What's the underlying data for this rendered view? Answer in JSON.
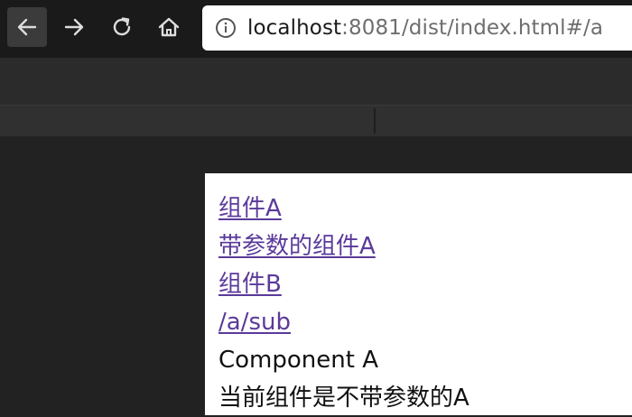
{
  "browser": {
    "url_host": "localhost",
    "url_rest": ":8081/dist/index.html#/a",
    "icons": {
      "back": "back-arrow-icon",
      "forward": "forward-arrow-icon",
      "reload": "reload-icon",
      "home": "home-icon",
      "info": "info-icon"
    }
  },
  "page": {
    "links": [
      {
        "label": "组件A"
      },
      {
        "label": "带参数的组件A"
      },
      {
        "label": "组件B"
      },
      {
        "label": "/a/sub"
      }
    ],
    "component_title": "Component A",
    "component_desc": "当前组件是不带参数的A"
  },
  "colors": {
    "link": "#5b3a9a",
    "toolbar_bg": "#1a1a1a",
    "page_bg": "#222222"
  }
}
